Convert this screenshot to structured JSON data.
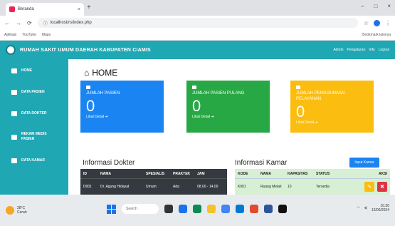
{
  "browser": {
    "tab_title": "Beranda",
    "tab_close": "×",
    "new_tab": "+",
    "window_controls": [
      "–",
      "□",
      "×"
    ],
    "url": "localhost/rs/index.php",
    "nav_back": "←",
    "nav_forward": "→",
    "nav_reload": "⟳",
    "info_icon": "ⓘ",
    "star": "☆",
    "menu": "⋮",
    "bookmarks": [
      "Aplikasi",
      "YouTube",
      "Maps"
    ],
    "bookmarks_right": "Bookmark lainnya"
  },
  "navbar": {
    "title": "RUMAH SAKIT UMUM DAERAH KABUPATEN CIAMIS",
    "right_items": [
      "Admin",
      "Pengaturan",
      "Info",
      "Logout"
    ]
  },
  "sidebar": {
    "items": [
      {
        "label": "HOME"
      },
      {
        "label": "DATA PASIEN"
      },
      {
        "label": "DATA DOKTER"
      },
      {
        "label": "REKAM MEDIS PASIEN"
      },
      {
        "label": "DATA KAMAR"
      }
    ]
  },
  "main": {
    "title": "HOME",
    "cards": [
      {
        "label": "JUMLAH PASIEN",
        "value": "0",
        "more": "Lihat Detail ➜",
        "color": "#1a84f2"
      },
      {
        "label": "JUMLAH PASIEN PULANG",
        "value": "0",
        "more": "Lihat Detail ➜",
        "color": "#28a745"
      },
      {
        "label": "JUMLAH PENGGUNAAN PELAYANAN",
        "value": "0",
        "more": "Lihat Detail ➜",
        "color": "#fbbd0f"
      }
    ],
    "dokter": {
      "title": "Informasi Dokter",
      "headers": [
        "ID",
        "NAMA",
        "SPESIALIS",
        "PRAKTEK",
        "JAM"
      ],
      "rows": [
        [
          "D001",
          "Dr. Agung Hidayat",
          "Umum",
          "Ada",
          "08.00 - 14.00"
        ]
      ]
    },
    "kamar": {
      "title": "Informasi Kamar",
      "button": "Input Kamar",
      "headers": [
        "KODE",
        "NAMA",
        "KAPASITAS",
        "STATUS",
        "AKSI"
      ],
      "rows": [
        [
          "K001",
          "Ruang Melati",
          "10",
          "Tersedia"
        ]
      ]
    }
  },
  "taskbar": {
    "weather_temp": "28°C",
    "weather_desc": "Cerah",
    "search_placeholder": "Search",
    "time": "10.30",
    "date": "12/06/2024"
  }
}
